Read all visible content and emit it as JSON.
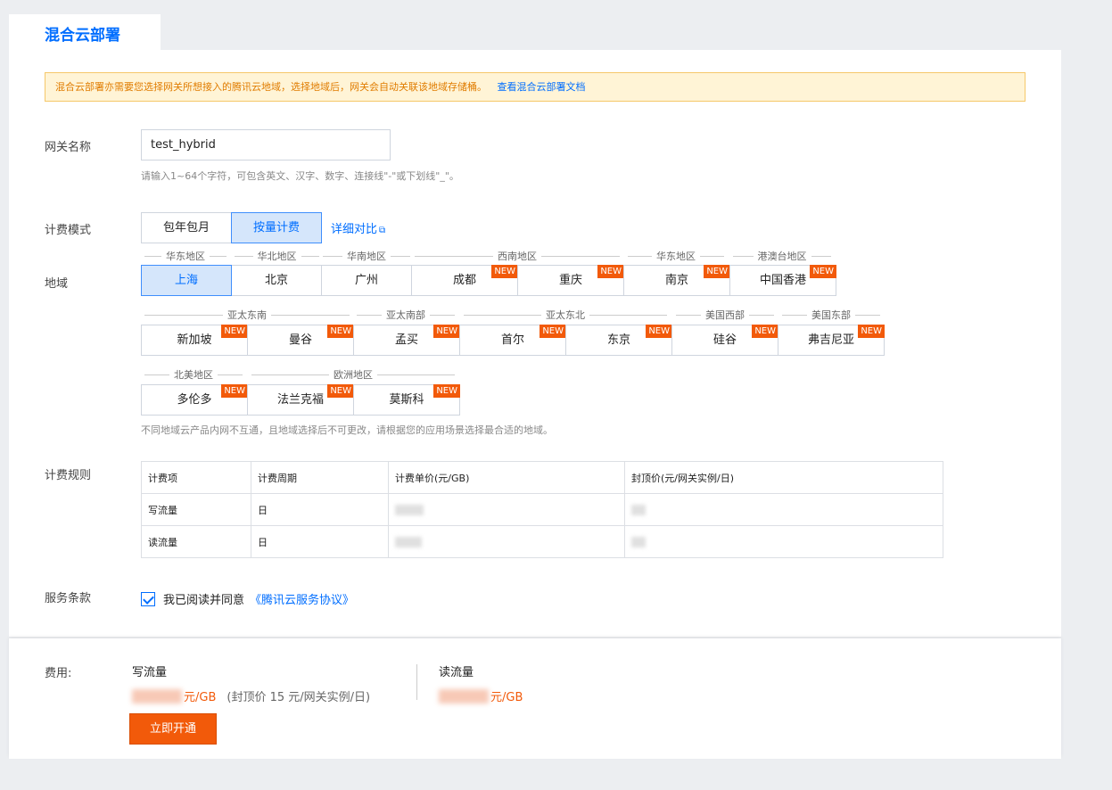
{
  "tab": {
    "label": "混合云部署"
  },
  "notice": {
    "text": "混合云部署亦需要您选择网关所想接入的腾讯云地域，选择地域后，网关会自动关联该地域存储桶。",
    "link": "查看混合云部署文档"
  },
  "gateway_name": {
    "label": "网关名称",
    "value": "test_hybrid",
    "hint": "请输入1~64个字符，可包含英文、汉字、数字、连接线\"-\"或下划线\"_\"。"
  },
  "billing": {
    "label": "计费模式",
    "options": [
      "包年包月",
      "按量计费"
    ],
    "selected": "按量计费",
    "compare_link": "详细对比"
  },
  "region": {
    "label": "地域",
    "badge": "NEW",
    "groups": [
      "华东地区",
      "华北地区",
      "华南地区",
      "西南地区",
      "华东地区",
      "港澳台地区",
      "亚太东南",
      "亚太南部",
      "亚太东北",
      "美国西部",
      "美国东部",
      "北美地区",
      "欧洲地区"
    ],
    "rows": [
      [
        {
          "name": "上海",
          "new": false,
          "selected": true
        },
        {
          "name": "北京",
          "new": false
        },
        {
          "name": "广州",
          "new": false
        },
        {
          "name": "成都",
          "new": true
        },
        {
          "name": "重庆",
          "new": true
        },
        {
          "name": "南京",
          "new": true
        },
        {
          "name": "中国香港",
          "new": true
        }
      ],
      [
        {
          "name": "新加坡",
          "new": true
        },
        {
          "name": "曼谷",
          "new": true
        },
        {
          "name": "孟买",
          "new": true
        },
        {
          "name": "首尔",
          "new": true
        },
        {
          "name": "东京",
          "new": true
        },
        {
          "name": "硅谷",
          "new": true
        },
        {
          "name": "弗吉尼亚",
          "new": true
        }
      ],
      [
        {
          "name": "多伦多",
          "new": true
        },
        {
          "name": "法兰克福",
          "new": true
        },
        {
          "name": "莫斯科",
          "new": true
        }
      ]
    ],
    "hint": "不同地域云产品内网不互通，且地域选择后不可更改，请根据您的应用场景选择最合适的地域。"
  },
  "pricing_rules": {
    "label": "计费规则",
    "headers": [
      "计费项",
      "计费周期",
      "计费单价(元/GB)",
      "封顶价(元/网关实例/日)"
    ],
    "rows": [
      [
        "写流量",
        "日"
      ],
      [
        "读流量",
        "日"
      ]
    ]
  },
  "terms": {
    "label": "服务条款",
    "checked": true,
    "text": "我已阅读并同意",
    "link": "《腾讯云服务协议》"
  },
  "footer": {
    "fee_label": "费用:",
    "write": {
      "title": "写流量",
      "unit": "元/GB",
      "cap_text": "(封顶价 15 元/网关实例/日)"
    },
    "read": {
      "title": "读流量",
      "unit": "元/GB"
    },
    "open_button": "立即开通"
  },
  "colors": {
    "accent": "#006eff",
    "orange": "#f25a0a",
    "selected_bg": "#d5e6fb"
  }
}
